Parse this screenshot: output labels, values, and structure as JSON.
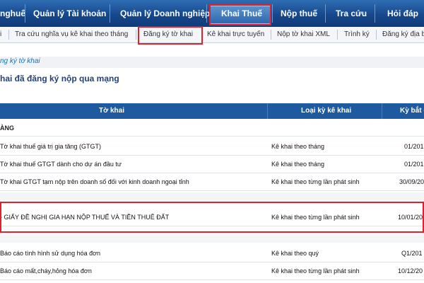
{
  "topnav": {
    "items": [
      "nghuế",
      "Quản lý Tài khoản",
      "Quản lý Doanh nghiệp",
      "Khai Thuế",
      "Nộp thuế",
      "Tra cứu",
      "Hỏi đáp"
    ],
    "active": "Khai Thuế"
  },
  "subnav": {
    "items": [
      "i",
      "Tra cứu nghĩa vụ kê khai theo tháng",
      "Đăng ký tờ khai",
      "Kê khai trực tuyến",
      "Nộp tờ khai XML",
      "Trình ký",
      "Đăng ký địa b"
    ],
    "active": "Đăng ký tờ khai"
  },
  "breadcrumb": "ng ký tờ khai",
  "page_title": "hai đã đăng ký nộp qua mạng",
  "table": {
    "headers": [
      "Tờ khai",
      "Loại kỳ kê khai",
      "Kỳ bắt đ"
    ],
    "groups": [
      {
        "title": "ÀNG",
        "rows": [
          {
            "name": "Tờ khai thuế giá trị gia tăng (GTGT)",
            "type": "Kê khai theo tháng",
            "start": "01/201"
          },
          {
            "name": "Tờ khai thuế GTGT dành cho dự án đầu tư",
            "type": "Kê khai theo tháng",
            "start": "01/201"
          },
          {
            "name": "Tờ khai GTGT tạm nộp trên doanh số đối với kinh doanh ngoại tỉnh",
            "type": "Kê khai theo từng lần phát sinh",
            "start": "30/09/20"
          }
        ]
      },
      {
        "title": "",
        "rows": [
          {
            "name": "- GIẤY ĐỀ NGHỊ GIA HẠN NỘP THUẾ VÀ TIỀN THUÊ ĐẤT",
            "type": "Kê khai theo từng lần phát sinh",
            "start": "10/01/20"
          }
        ]
      },
      {
        "title": "",
        "rows": [
          {
            "name": "Báo cáo tình hình sử dụng hóa đơn",
            "type": "Kê khai theo quý",
            "start": "Q1/201"
          },
          {
            "name": "Báo cáo mất,cháy,hỏng hóa đơn",
            "type": "Kê khai theo từng lần phát sinh",
            "start": "10/12/20"
          }
        ]
      }
    ]
  },
  "colors": {
    "nav": "#16488d",
    "header": "#1e5aa0",
    "highlight": "#e0202a",
    "link": "#1a73b5"
  }
}
